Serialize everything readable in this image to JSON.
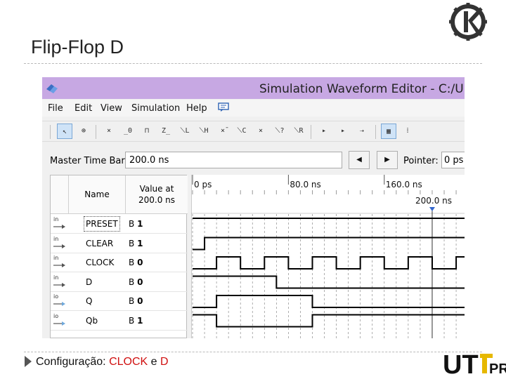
{
  "slide": {
    "title": "Flip-Flop D",
    "bullet": {
      "prefix": "Configuração: ",
      "clock": "CLOCK",
      "conj": " e ",
      "d": "D"
    },
    "bottom_logo_text": "UTFPR"
  },
  "window": {
    "title": "Simulation Waveform Editor - C:/U",
    "titlebar_color": "#c7a8e3",
    "menu": [
      "File",
      "Edit",
      "View",
      "Simulation",
      "Help"
    ],
    "toolbar_icons": [
      {
        "name": "select-tool-icon",
        "active": true
      },
      {
        "name": "zoom-tool-icon"
      },
      {
        "name": "uninitialized-icon"
      },
      {
        "name": "force-low-icon"
      },
      {
        "name": "force-high-icon"
      },
      {
        "name": "high-impedance-icon"
      },
      {
        "name": "weak-low-icon"
      },
      {
        "name": "weak-high-icon"
      },
      {
        "name": "invert-icon"
      },
      {
        "name": "count-value-icon"
      },
      {
        "name": "forcing-unknown-icon"
      },
      {
        "name": "dont-care-icon"
      },
      {
        "name": "random-values-icon"
      },
      {
        "name": "run-functional-simulation-icon"
      },
      {
        "name": "run-timing-simulation-icon"
      },
      {
        "name": "generate-netlist-icon"
      },
      {
        "name": "grid-snap-icon",
        "active": true
      },
      {
        "name": "snap-to-transitions-icon"
      }
    ],
    "master_time_bar": {
      "label": "Master Time Bar:",
      "value": "200.0 ns"
    },
    "nav_prev_glyph": "◀",
    "nav_next_glyph": "▶",
    "pointer": {
      "label": "Pointer:",
      "value": "0 ps"
    },
    "columns": {
      "name": "Name",
      "value_line1": "Value at",
      "value_line2": "200.0 ns"
    },
    "signals": [
      {
        "type": "in",
        "name": "PRESET",
        "value_radix": "B",
        "value": "1"
      },
      {
        "type": "in",
        "name": "CLEAR",
        "value_radix": "B",
        "value": "1"
      },
      {
        "type": "in",
        "name": "CLOCK",
        "value_radix": "B",
        "value": "0"
      },
      {
        "type": "in",
        "name": "D",
        "value_radix": "B",
        "value": "0"
      },
      {
        "type": "io",
        "name": "Q",
        "value_radix": "B",
        "value": "0"
      },
      {
        "type": "io",
        "name": "Qb",
        "value_radix": "B",
        "value": "1"
      }
    ],
    "timeline": {
      "ticks": [
        "0 ps",
        "80.0 ns",
        "160.0 ns"
      ],
      "tick_times_ns": [
        0,
        80,
        160
      ],
      "cursor_label": "200.0 ns",
      "cursor_time_ns": 200,
      "visible_end_ns": 227
    },
    "waveforms": {
      "PRESET": [
        [
          0,
          1
        ]
      ],
      "CLEAR": [
        [
          0,
          0
        ],
        [
          10,
          1
        ]
      ],
      "CLOCK": [
        [
          0,
          0
        ],
        [
          20,
          1
        ],
        [
          40,
          0
        ],
        [
          60,
          1
        ],
        [
          80,
          0
        ],
        [
          100,
          1
        ],
        [
          120,
          0
        ],
        [
          140,
          1
        ],
        [
          160,
          0
        ],
        [
          180,
          1
        ],
        [
          200,
          0
        ],
        [
          220,
          1
        ]
      ],
      "D": [
        [
          0,
          1
        ],
        [
          70,
          0
        ]
      ],
      "Q": [
        [
          0,
          0
        ],
        [
          20,
          1
        ],
        [
          100,
          0
        ]
      ],
      "Qb": [
        [
          0,
          1
        ],
        [
          20,
          0
        ],
        [
          100,
          1
        ]
      ]
    }
  }
}
